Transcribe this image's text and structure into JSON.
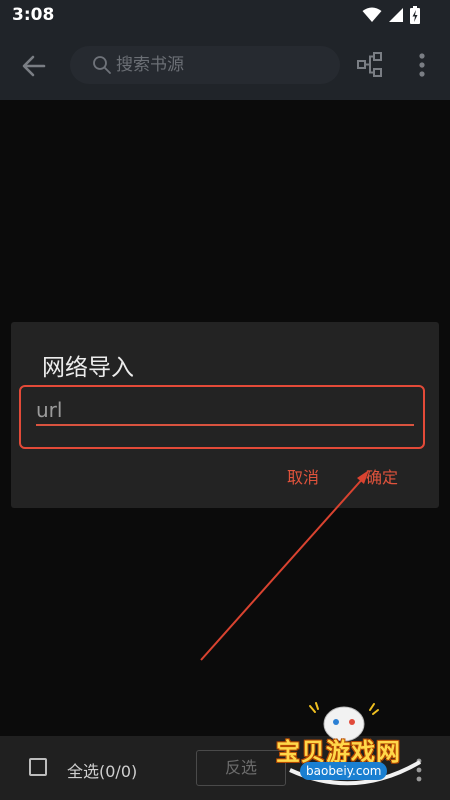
{
  "status_bar": {
    "time": "3:08"
  },
  "toolbar": {
    "search_placeholder": "搜索书源",
    "icons": [
      "back-arrow-icon",
      "search-icon",
      "group-icon",
      "more-vert-icon"
    ]
  },
  "dialog": {
    "title": "网络导入",
    "input_placeholder": "url",
    "cancel_label": "取消",
    "ok_label": "确定"
  },
  "bottom_bar": {
    "select_all_label": "全选(0/0)",
    "invert_label": "反选"
  },
  "watermark": {
    "title": "宝贝游戏网",
    "url": "baobeiy.com"
  },
  "colors": {
    "toolbar_bg": "#202429",
    "dialog_bg": "#232323",
    "accent_red": "#e0533c",
    "background": "#0b0b0b"
  }
}
